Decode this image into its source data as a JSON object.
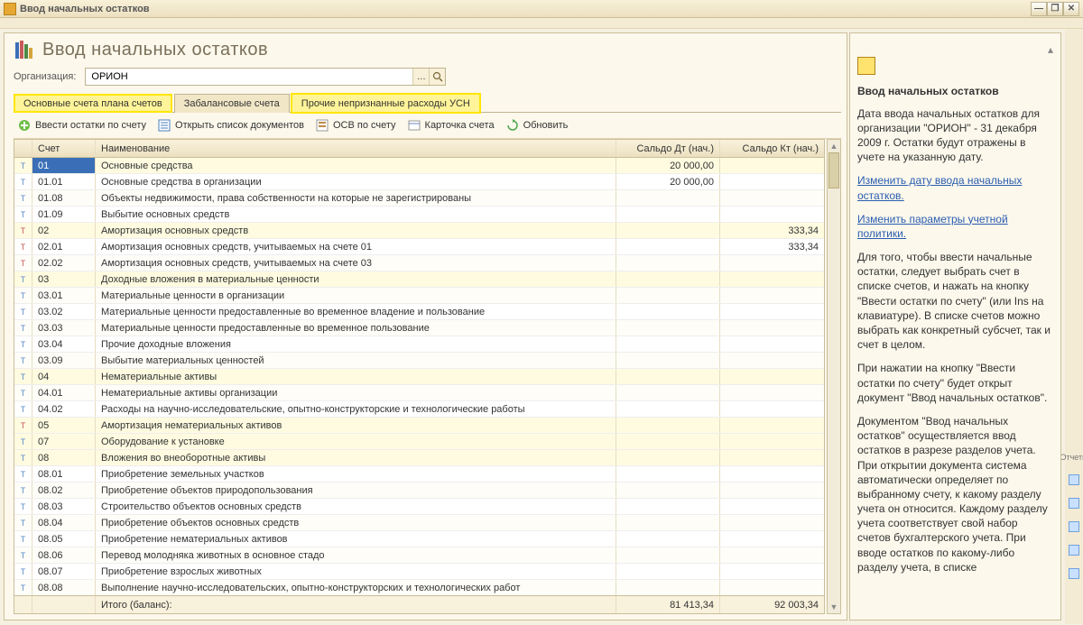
{
  "window": {
    "title": "Ввод начальных остатков"
  },
  "page": {
    "title": "Ввод начальных остатков"
  },
  "org": {
    "label": "Организация:",
    "value": "ОРИОН"
  },
  "tabs": [
    {
      "label": "Основные счета плана счетов",
      "active": true
    },
    {
      "label": "Забалансовые счета",
      "active": false
    },
    {
      "label": "Прочие непризнанные расходы УСН",
      "active": false,
      "highlight": true
    }
  ],
  "actions": {
    "enter": "Ввести остатки по счету",
    "openList": "Открыть список документов",
    "osv": "ОСВ по счету",
    "card": "Карточка счета",
    "refresh": "Обновить"
  },
  "table": {
    "headers": {
      "acc": "Счет",
      "name": "Наименование",
      "dt": "Сальдо Дт (нач.)",
      "kt": "Сальдо Кт (нач.)"
    },
    "rows": [
      {
        "i": "a",
        "acc": "01",
        "name": "Основные средства",
        "dt": "20 000,00",
        "kt": "",
        "sel": true,
        "hl": true
      },
      {
        "i": "a",
        "acc": "01.01",
        "name": "Основные средства в организации",
        "dt": "20 000,00",
        "kt": ""
      },
      {
        "i": "a",
        "acc": "01.08",
        "name": "Объекты недвижимости, права собственности на которые не зарегистрированы",
        "dt": "",
        "kt": ""
      },
      {
        "i": "a",
        "acc": "01.09",
        "name": "Выбытие основных средств",
        "dt": "",
        "kt": ""
      },
      {
        "i": "p",
        "acc": "02",
        "name": "Амортизация основных средств",
        "dt": "",
        "kt": "333,34",
        "hl": true
      },
      {
        "i": "p",
        "acc": "02.01",
        "name": "Амортизация основных средств, учитываемых на счете 01",
        "dt": "",
        "kt": "333,34"
      },
      {
        "i": "p",
        "acc": "02.02",
        "name": "Амортизация основных средств, учитываемых на счете 03",
        "dt": "",
        "kt": ""
      },
      {
        "i": "a",
        "acc": "03",
        "name": "Доходные вложения в материальные ценности",
        "dt": "",
        "kt": "",
        "hl": true
      },
      {
        "i": "a",
        "acc": "03.01",
        "name": "Материальные ценности в организации",
        "dt": "",
        "kt": ""
      },
      {
        "i": "a",
        "acc": "03.02",
        "name": "Материальные ценности предоставленные во временное владение и пользование",
        "dt": "",
        "kt": ""
      },
      {
        "i": "a",
        "acc": "03.03",
        "name": "Материальные ценности предоставленные во временное пользование",
        "dt": "",
        "kt": ""
      },
      {
        "i": "a",
        "acc": "03.04",
        "name": "Прочие доходные вложения",
        "dt": "",
        "kt": ""
      },
      {
        "i": "a",
        "acc": "03.09",
        "name": "Выбытие материальных ценностей",
        "dt": "",
        "kt": ""
      },
      {
        "i": "a",
        "acc": "04",
        "name": "Нематериальные активы",
        "dt": "",
        "kt": "",
        "hl": true
      },
      {
        "i": "a",
        "acc": "04.01",
        "name": "Нематериальные активы организации",
        "dt": "",
        "kt": ""
      },
      {
        "i": "a",
        "acc": "04.02",
        "name": "Расходы на научно-исследовательские, опытно-конструкторские и технологические работы",
        "dt": "",
        "kt": ""
      },
      {
        "i": "p",
        "acc": "05",
        "name": "Амортизация нематериальных активов",
        "dt": "",
        "kt": "",
        "hl": true
      },
      {
        "i": "a",
        "acc": "07",
        "name": "Оборудование к установке",
        "dt": "",
        "kt": "",
        "hl": true
      },
      {
        "i": "a",
        "acc": "08",
        "name": "Вложения во внеоборотные активы",
        "dt": "",
        "kt": "",
        "hl": true
      },
      {
        "i": "a",
        "acc": "08.01",
        "name": "Приобретение земельных участков",
        "dt": "",
        "kt": ""
      },
      {
        "i": "a",
        "acc": "08.02",
        "name": "Приобретение объектов природопользования",
        "dt": "",
        "kt": ""
      },
      {
        "i": "a",
        "acc": "08.03",
        "name": "Строительство объектов основных средств",
        "dt": "",
        "kt": ""
      },
      {
        "i": "a",
        "acc": "08.04",
        "name": "Приобретение объектов основных средств",
        "dt": "",
        "kt": ""
      },
      {
        "i": "a",
        "acc": "08.05",
        "name": "Приобретение нематериальных активов",
        "dt": "",
        "kt": ""
      },
      {
        "i": "a",
        "acc": "08.06",
        "name": "Перевод молодняка животных в основное стадо",
        "dt": "",
        "kt": ""
      },
      {
        "i": "a",
        "acc": "08.07",
        "name": "Приобретение взрослых животных",
        "dt": "",
        "kt": ""
      },
      {
        "i": "a",
        "acc": "08.08",
        "name": "Выполнение научно-исследовательских, опытно-конструкторских и технологических работ",
        "dt": "",
        "kt": ""
      }
    ],
    "footer": {
      "label": "Итого (баланс):",
      "dt": "81 413,34",
      "kt": "92 003,34"
    }
  },
  "side": {
    "title": "Ввод начальных остатков",
    "p1": "Дата ввода начальных остатков для организации \"ОРИОН\" - 31 декабря 2009 г. Остатки будут отражены в учете на указанную дату.",
    "link1": "Изменить дату ввода начальных остатков.",
    "link2": "Изменить параметры учетной политики.",
    "p2": "Для того, чтобы ввести начальные остатки, следует выбрать счет в списке счетов, и нажать на кнопку \"Ввести остатки по счету\" (или Ins на клавиатуре). В списке счетов можно выбрать как конкретный субсчет, так и счет в целом.",
    "p3": "При нажатии на кнопку \"Ввести остатки по счету\" будет открыт документ \"Ввод начальных остатков\".",
    "p4": "Документом \"Ввод начальных остатков\" осуществляется ввод остатков в разрезе разделов учета. При открытии документа система автоматически определяет по выбранному счету, к какому разделу учета он относится. Каждому разделу учета соответствует свой набор счетов бухгалтерского учета. При вводе остатков по какому-либо разделу учета, в списке"
  },
  "sliver": {
    "label": "Отчеты"
  }
}
